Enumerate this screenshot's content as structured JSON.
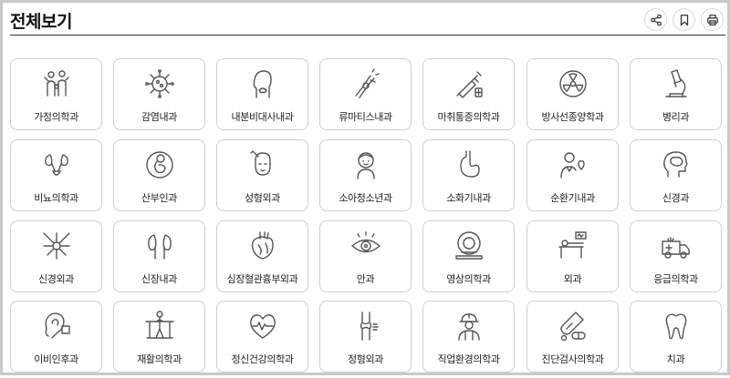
{
  "header": {
    "title": "전체보기",
    "tools": [
      {
        "name": "share-icon"
      },
      {
        "name": "bookmark-icon"
      },
      {
        "name": "print-icon"
      }
    ]
  },
  "departments": [
    {
      "label": "가정의학과",
      "icon": "family-icon"
    },
    {
      "label": "감염내과",
      "icon": "virus-icon"
    },
    {
      "label": "내분비대사내과",
      "icon": "thyroid-icon"
    },
    {
      "label": "류마티스내과",
      "icon": "joint-pain-icon"
    },
    {
      "label": "마취통증의학과",
      "icon": "syringe-icon"
    },
    {
      "label": "방사선종양학과",
      "icon": "radiation-icon"
    },
    {
      "label": "병리과",
      "icon": "microscope-icon"
    },
    {
      "label": "비뇨의학과",
      "icon": "kidney-bladder-icon"
    },
    {
      "label": "산부인과",
      "icon": "fetus-icon"
    },
    {
      "label": "성형외과",
      "icon": "face-surgery-icon"
    },
    {
      "label": "소아청소년과",
      "icon": "child-icon"
    },
    {
      "label": "소화기내과",
      "icon": "stomach-icon"
    },
    {
      "label": "순환기내과",
      "icon": "doctor-heart-icon"
    },
    {
      "label": "신경과",
      "icon": "brain-head-icon"
    },
    {
      "label": "신경외과",
      "icon": "neuron-icon"
    },
    {
      "label": "신장내과",
      "icon": "kidneys-icon"
    },
    {
      "label": "심장혈관흉부외과",
      "icon": "anatomical-heart-icon"
    },
    {
      "label": "안과",
      "icon": "eye-icon"
    },
    {
      "label": "영상의학과",
      "icon": "mri-scanner-icon"
    },
    {
      "label": "외과",
      "icon": "operating-table-icon"
    },
    {
      "label": "응급의학과",
      "icon": "ambulance-icon"
    },
    {
      "label": "이비인후과",
      "icon": "ear-icon"
    },
    {
      "label": "재활의학과",
      "icon": "rehab-bars-icon"
    },
    {
      "label": "정신건강의학과",
      "icon": "heart-pulse-icon"
    },
    {
      "label": "정형외과",
      "icon": "knee-joint-icon"
    },
    {
      "label": "직업환경의학과",
      "icon": "worker-icon"
    },
    {
      "label": "진단검사의학과",
      "icon": "test-tube-pill-icon"
    },
    {
      "label": "치과",
      "icon": "tooth-icon"
    }
  ]
}
